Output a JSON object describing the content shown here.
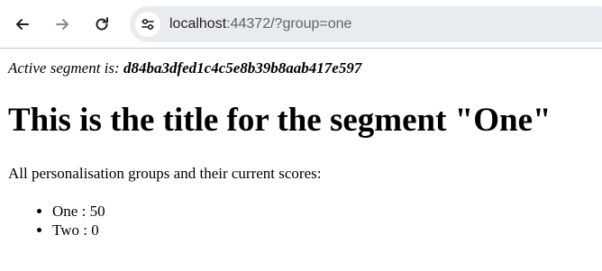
{
  "browser": {
    "url_host": "localhost",
    "url_rest": ":44372/?group=one"
  },
  "page": {
    "active_label": "Active segment is: ",
    "active_value": "d84ba3dfed1c4c5e8b39b8aab417e597",
    "title": "This is the title for the segment \"One\"",
    "intro": "All personalisation groups and their current scores:",
    "groups": [
      {
        "name": "One",
        "score": "50"
      },
      {
        "name": "Two",
        "score": "0"
      }
    ]
  }
}
